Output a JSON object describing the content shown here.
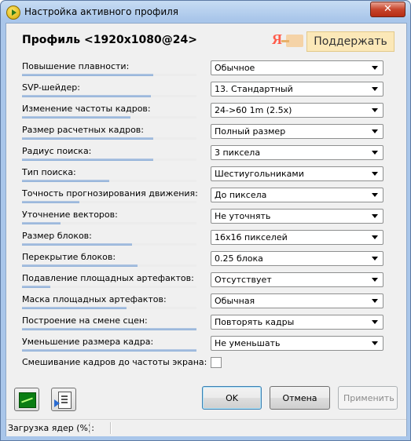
{
  "window": {
    "title": "Настройка активного профиля",
    "close_glyph": "✕"
  },
  "header": {
    "profile_title": "Профиль <1920x1080@24>",
    "donate": {
      "logo": "Я",
      "label": "Поддержать"
    }
  },
  "settings": [
    {
      "label": "Повышение плавности:",
      "value": "Обычное",
      "level": 0.75
    },
    {
      "label": "SVP-шейдер:",
      "value": "13. Стандартный",
      "level": 0.74
    },
    {
      "label": "Изменение частоты кадров:",
      "value": "24->60 1m (2.5x)",
      "level": 0.62
    },
    {
      "label": "Размер расчетных кадров:",
      "value": "Полный размер",
      "level": 0.75
    },
    {
      "label": "Радиус поиска:",
      "value": "3 пиксела",
      "level": 0.75
    },
    {
      "label": "Тип поиска:",
      "value": "Шестиугольниками",
      "level": 0.5
    },
    {
      "label": "Точность прогнозирования движения:",
      "value": "До пиксела",
      "level": 0.33
    },
    {
      "label": "Уточнение векторов:",
      "value": "Не уточнять",
      "level": 0.22
    },
    {
      "label": "Размер блоков:",
      "value": "16x16 пикселей",
      "level": 0.63
    },
    {
      "label": "Перекрытие блоков:",
      "value": "0.25 блока",
      "level": 0.66
    },
    {
      "label": "Подавление площадных артефактов:",
      "value": "Отсутствует",
      "level": 0.16
    },
    {
      "label": "Маска площадных артефактов:",
      "value": "Обычная",
      "level": 0.6
    },
    {
      "label": "Построение на смене сцен:",
      "value": "Повторять кадры",
      "level": 1.0
    },
    {
      "label": "Уменьшение размера кадра:",
      "value": "Не уменьшать",
      "level": 1.0
    }
  ],
  "checkbox_row": {
    "label": "Смешивание кадров до частоты экрана:",
    "checked": false
  },
  "buttons": {
    "ok": "OK",
    "cancel": "Отмена",
    "apply": "Применить"
  },
  "statusbar": {
    "text": "Загрузка ядер (%):"
  }
}
